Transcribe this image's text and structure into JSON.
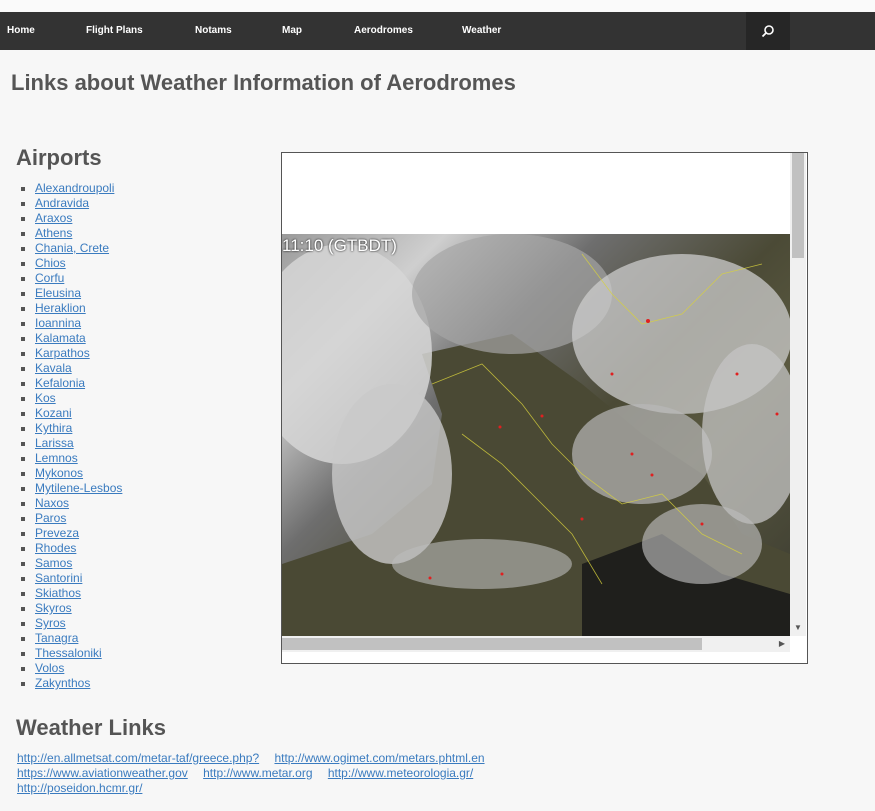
{
  "nav": {
    "items": [
      "Home",
      "Flight Plans",
      "Notams",
      "Map",
      "Aerodromes",
      "Weather"
    ],
    "search_icon": "search-icon"
  },
  "page_title": "Links about Weather Information of Aerodromes",
  "airports": {
    "heading": "Airports",
    "items": [
      "Alexandroupoli",
      "Andravida",
      "Araxos",
      "Athens",
      "Chania, Crete",
      "Chios",
      "Corfu",
      "Eleusina",
      "Heraklion",
      "Ioannina",
      "Kalamata",
      "Karpathos",
      "Kavala",
      "Kefalonia",
      "Kos",
      "Kozani",
      "Kythira",
      "Larissa",
      "Lemnos",
      "Mykonos",
      "Mytilene-Lesbos",
      "Naxos",
      "Paros",
      "Preveza",
      "Rhodes",
      "Samos",
      "Santorini",
      "Skiathos",
      "Skyros",
      "Syros",
      "Tanagra",
      "Thessaloniki",
      "Volos",
      "Zakynthos"
    ]
  },
  "satellite": {
    "timestamp": "11:10 (GTBDT)"
  },
  "weather_links": {
    "heading": "Weather Links",
    "links": [
      "http://en.allmetsat.com/metar-taf/greece.php?",
      "http://www.ogimet.com/metars.phtml.en",
      "https://www.aviationweather.gov",
      "http://www.metar.org",
      "http://www.meteorologia.gr/",
      "http://poseidon.hcmr.gr/"
    ]
  }
}
